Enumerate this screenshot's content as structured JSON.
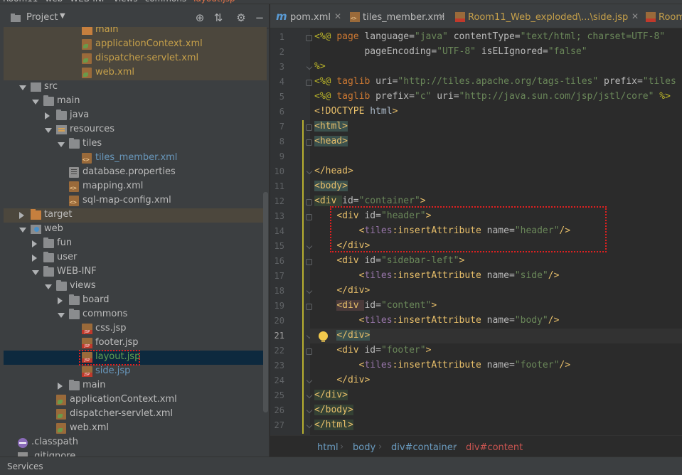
{
  "topbar": {
    "crumbs": [
      "Room11",
      "web",
      "WEB-INF",
      "views",
      "commons",
      "layout.jsp"
    ]
  },
  "project_panel": {
    "title": "Project",
    "toolbar": {
      "locate_icon": "crosshair-icon",
      "collapse_icon": "collapse-icon",
      "settings_icon": "gear-icon",
      "hide_icon": "minimize-icon"
    },
    "tree": [
      {
        "label": "main",
        "indent": 0,
        "icon": "folder-orange",
        "arrow": "none",
        "style": "orange",
        "modified": true,
        "partial": true
      },
      {
        "label": "applicationContext.xml",
        "icon": "spring",
        "style": "orange",
        "modified": true
      },
      {
        "label": "dispatcher-servlet.xml",
        "icon": "spring",
        "style": "orange",
        "modified": true
      },
      {
        "label": "web.xml",
        "icon": "spring",
        "style": "orange",
        "modified": true
      },
      {
        "label": "src",
        "icon": "folder-src",
        "arrow": "open",
        "style": "normal"
      },
      {
        "label": "main",
        "icon": "folder",
        "arrow": "open",
        "style": "normal"
      },
      {
        "label": "java",
        "icon": "folder",
        "arrow": "closed",
        "style": "normal"
      },
      {
        "label": "resources",
        "icon": "folder-res",
        "arrow": "open",
        "style": "normal"
      },
      {
        "label": "tiles",
        "icon": "folder",
        "arrow": "open",
        "style": "normal"
      },
      {
        "label": "tiles_member.xml",
        "icon": "xml",
        "style": "blue"
      },
      {
        "label": "database.properties",
        "icon": "props",
        "style": "normal"
      },
      {
        "label": "mapping.xml",
        "icon": "xml",
        "style": "normal"
      },
      {
        "label": "sql-map-config.xml",
        "icon": "xml",
        "style": "normal"
      },
      {
        "label": "target",
        "icon": "folder-orange",
        "arrow": "closed",
        "style": "normal",
        "modified": true
      },
      {
        "label": "web",
        "icon": "folder-web",
        "arrow": "open",
        "style": "normal"
      },
      {
        "label": "fun",
        "icon": "folder",
        "arrow": "closed",
        "style": "normal"
      },
      {
        "label": "user",
        "icon": "folder",
        "arrow": "closed",
        "style": "normal"
      },
      {
        "label": "WEB-INF",
        "icon": "folder",
        "arrow": "open",
        "style": "normal"
      },
      {
        "label": "views",
        "icon": "folder",
        "arrow": "open",
        "style": "normal"
      },
      {
        "label": "board",
        "icon": "folder",
        "arrow": "closed",
        "style": "normal"
      },
      {
        "label": "commons",
        "icon": "folder",
        "arrow": "open",
        "style": "normal"
      },
      {
        "label": "css.jsp",
        "icon": "jsp",
        "style": "normal"
      },
      {
        "label": "footer.jsp",
        "icon": "jsp",
        "style": "normal"
      },
      {
        "label": "layout.jsp",
        "icon": "jsp",
        "style": "green",
        "selected": true
      },
      {
        "label": "side.jsp",
        "icon": "jsp",
        "style": "blue"
      },
      {
        "label": "main",
        "icon": "folder",
        "arrow": "closed",
        "style": "normal"
      },
      {
        "label": "applicationContext.xml",
        "icon": "spring",
        "style": "normal"
      },
      {
        "label": "dispatcher-servlet.xml",
        "icon": "spring",
        "style": "normal"
      },
      {
        "label": "web.xml",
        "icon": "spring",
        "style": "normal"
      },
      {
        "label": ".classpath",
        "icon": "classpath",
        "style": "normal"
      },
      {
        "label": ".gitignore",
        "icon": "gitfile",
        "style": "normal"
      }
    ]
  },
  "tabs": [
    {
      "label": "pom.xml",
      "icon": "maven-icon",
      "active": false
    },
    {
      "label": "tiles_member.xml",
      "icon": "xml-file-icon",
      "active": false
    },
    {
      "label": "Room11_Web_exploded\\...\\side.jsp",
      "icon": "jsp-file-icon",
      "active": false
    },
    {
      "label": "Room",
      "icon": "jsp-file-icon",
      "active": false
    }
  ],
  "editor": {
    "current_line": 21,
    "lines": [
      {
        "n": 1,
        "segs": [
          [
            "dir",
            "<%@ "
          ],
          [
            "kw",
            "page "
          ],
          [
            "attr",
            "language="
          ],
          [
            "str",
            "\"java\" "
          ],
          [
            "attr",
            "contentType="
          ],
          [
            "str",
            "\"text/html; charset=UTF-8\""
          ]
        ]
      },
      {
        "n": 2,
        "segs": [
          [
            "plain",
            "         "
          ],
          [
            "attr",
            "pageEncoding="
          ],
          [
            "str",
            "\"UTF-8\" "
          ],
          [
            "attr",
            "isELIgnored="
          ],
          [
            "str",
            "\"false\""
          ]
        ]
      },
      {
        "n": 3,
        "segs": [
          [
            "dir",
            "%>"
          ]
        ]
      },
      {
        "n": 4,
        "segs": [
          [
            "dir",
            "<%@ "
          ],
          [
            "kw",
            "taglib "
          ],
          [
            "attr",
            "uri="
          ],
          [
            "str",
            "\"http://tiles.apache.org/tags-tiles\" "
          ],
          [
            "attr",
            "prefix="
          ],
          [
            "str",
            "\"tiles"
          ]
        ]
      },
      {
        "n": 5,
        "segs": [
          [
            "dir",
            "<%@ "
          ],
          [
            "kw",
            "taglib "
          ],
          [
            "attr",
            "prefix="
          ],
          [
            "str",
            "\"c\" "
          ],
          [
            "attr",
            "uri="
          ],
          [
            "str",
            "\"http://java.sun.com/jsp/jstl/core\" "
          ],
          [
            "dir",
            "%>"
          ]
        ]
      },
      {
        "n": 6,
        "segs": [
          [
            "tag",
            "<!DOCTYPE "
          ],
          [
            "plain",
            "html"
          ],
          [
            "tag",
            ">"
          ]
        ]
      },
      {
        "n": 7,
        "segs": [
          [
            "tag",
            "<html>"
          ]
        ]
      },
      {
        "n": 8,
        "segs": [
          [
            "tag",
            "<head>"
          ]
        ]
      },
      {
        "n": 9,
        "segs": []
      },
      {
        "n": 10,
        "segs": [
          [
            "tag",
            "</head>"
          ]
        ]
      },
      {
        "n": 11,
        "segs": [
          [
            "tag",
            "<body>"
          ]
        ]
      },
      {
        "n": 12,
        "segs": [
          [
            "tag",
            "<div "
          ],
          [
            "attr",
            "id="
          ],
          [
            "str",
            "\"container\""
          ],
          [
            "tag",
            ">"
          ]
        ]
      },
      {
        "n": 13,
        "segs": [
          [
            "plain",
            "    "
          ],
          [
            "tag",
            "<div "
          ],
          [
            "attr",
            "id="
          ],
          [
            "str",
            "\"header\""
          ],
          [
            "tag",
            ">"
          ]
        ]
      },
      {
        "n": 14,
        "segs": [
          [
            "plain",
            "        "
          ],
          [
            "tag",
            "<"
          ],
          [
            "ns",
            "tiles"
          ],
          [
            "tag",
            ":insertAttribute "
          ],
          [
            "attr",
            "name="
          ],
          [
            "str",
            "\"header\""
          ],
          [
            "tag",
            "/>"
          ]
        ]
      },
      {
        "n": 15,
        "segs": [
          [
            "plain",
            "    "
          ],
          [
            "tag",
            "</div>"
          ]
        ]
      },
      {
        "n": 16,
        "segs": [
          [
            "plain",
            "    "
          ],
          [
            "tag",
            "<div "
          ],
          [
            "attr",
            "id="
          ],
          [
            "str",
            "\"sidebar-left\""
          ],
          [
            "tag",
            ">"
          ]
        ]
      },
      {
        "n": 17,
        "segs": [
          [
            "plain",
            "        "
          ],
          [
            "tag",
            "<"
          ],
          [
            "ns",
            "tiles"
          ],
          [
            "tag",
            ":insertAttribute "
          ],
          [
            "attr",
            "name="
          ],
          [
            "str",
            "\"side\""
          ],
          [
            "tag",
            "/>"
          ]
        ]
      },
      {
        "n": 18,
        "segs": [
          [
            "plain",
            "    "
          ],
          [
            "tag",
            "</div>"
          ]
        ]
      },
      {
        "n": 19,
        "segs": [
          [
            "plain",
            "    "
          ],
          [
            "tag",
            "<div "
          ],
          [
            "attr",
            "id="
          ],
          [
            "str",
            "\"content\""
          ],
          [
            "tag",
            ">"
          ]
        ]
      },
      {
        "n": 20,
        "segs": [
          [
            "plain",
            "        "
          ],
          [
            "tag",
            "<"
          ],
          [
            "ns",
            "tiles"
          ],
          [
            "tag",
            ":insertAttribute "
          ],
          [
            "attr",
            "name="
          ],
          [
            "str",
            "\"body\""
          ],
          [
            "tag",
            "/>"
          ]
        ]
      },
      {
        "n": 21,
        "segs": [
          [
            "plain",
            "    "
          ],
          [
            "tag",
            "</div>"
          ]
        ]
      },
      {
        "n": 22,
        "segs": [
          [
            "plain",
            "    "
          ],
          [
            "tag",
            "<div "
          ],
          [
            "attr",
            "id="
          ],
          [
            "str",
            "\"footer\""
          ],
          [
            "tag",
            ">"
          ]
        ]
      },
      {
        "n": 23,
        "segs": [
          [
            "plain",
            "        "
          ],
          [
            "tag",
            "<"
          ],
          [
            "ns",
            "tiles"
          ],
          [
            "tag",
            ":insertAttribute "
          ],
          [
            "attr",
            "name="
          ],
          [
            "str",
            "\"footer\""
          ],
          [
            "tag",
            "/>"
          ]
        ]
      },
      {
        "n": 24,
        "segs": [
          [
            "plain",
            "    "
          ],
          [
            "tag",
            "</div>"
          ]
        ]
      },
      {
        "n": 25,
        "segs": [
          [
            "tag",
            "</div>"
          ]
        ]
      },
      {
        "n": 26,
        "segs": [
          [
            "tag",
            "</body>"
          ]
        ]
      },
      {
        "n": 27,
        "segs": [
          [
            "tag",
            "</html>"
          ]
        ]
      }
    ]
  },
  "breadcrumb": [
    "html",
    "body",
    "div#container",
    "div#content"
  ],
  "status": {
    "services_label": "Services"
  },
  "colors": {
    "accent_red_dotted": "#e02020",
    "selection": "#0d293e",
    "modified_row": "#4c473d"
  }
}
